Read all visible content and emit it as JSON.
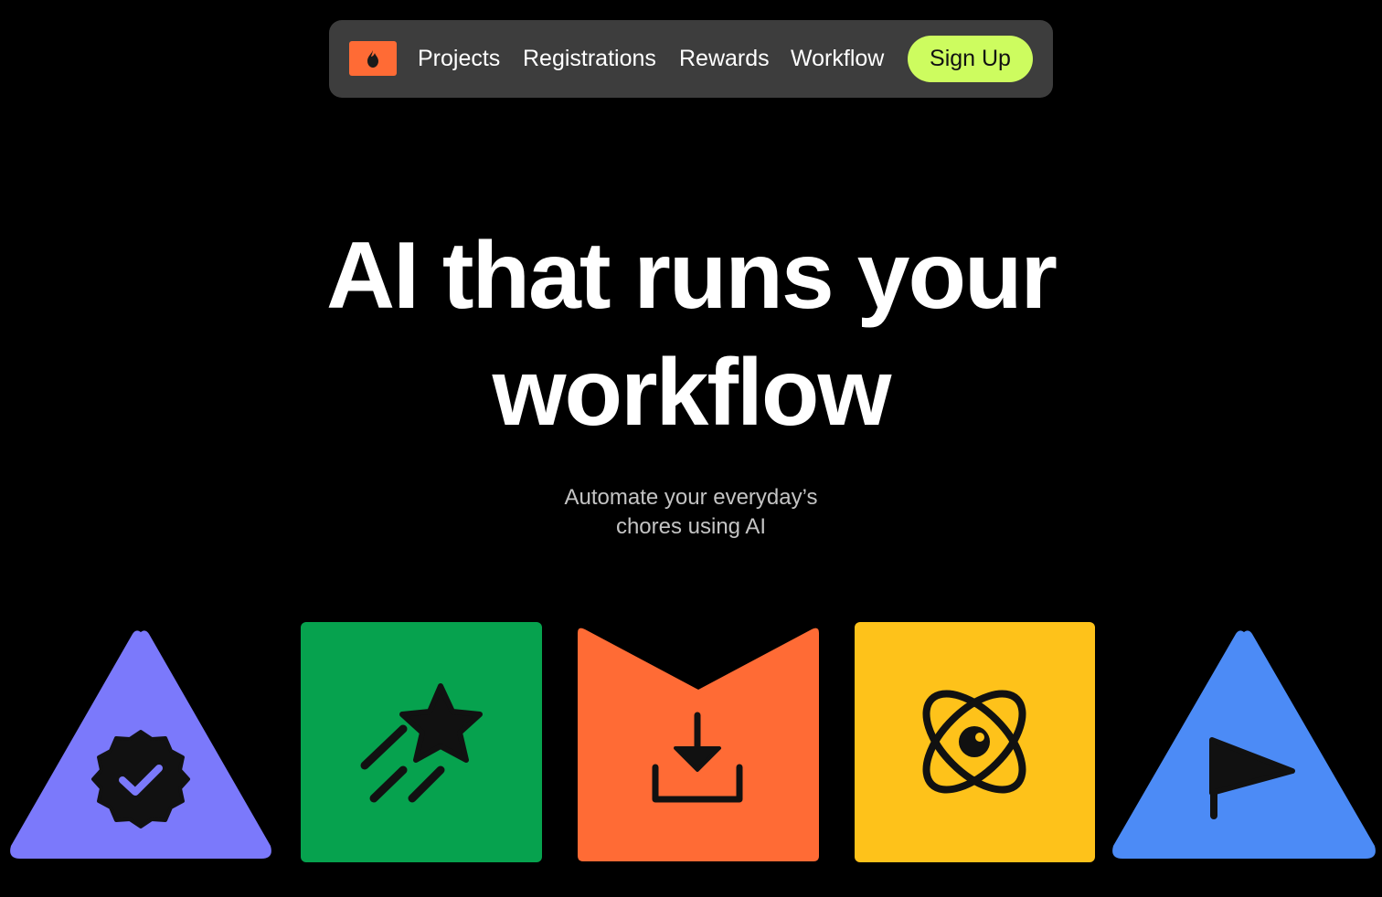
{
  "nav": {
    "logo_icon": "flame-icon",
    "links": [
      "Projects",
      "Registrations",
      "Rewards",
      "Workflow"
    ],
    "signup_label": "Sign Up"
  },
  "hero": {
    "headline_line1": "AI that runs your",
    "headline_line2": "workflow",
    "subtitle_line1": "Automate your everyday’s",
    "subtitle_line2": "chores using AI"
  },
  "cards": [
    {
      "shape": "triangle",
      "icon": "verified-badge-icon",
      "color": "#7b79fb"
    },
    {
      "shape": "square",
      "icon": "shooting-star-icon",
      "color": "#06a24e"
    },
    {
      "shape": "notched-square",
      "icon": "download-icon",
      "color": "#ff6b35"
    },
    {
      "shape": "square",
      "icon": "atom-icon",
      "color": "#fec21a"
    },
    {
      "shape": "triangle",
      "icon": "flag-icon",
      "color": "#4c8bf6"
    }
  ],
  "colors": {
    "background": "#000000",
    "nav_background": "#3d3d3d",
    "logo_background": "#ff6b35",
    "signup_background": "#cdfc5f",
    "text": "#ffffff",
    "subtitle_text": "#c4c4c4"
  }
}
